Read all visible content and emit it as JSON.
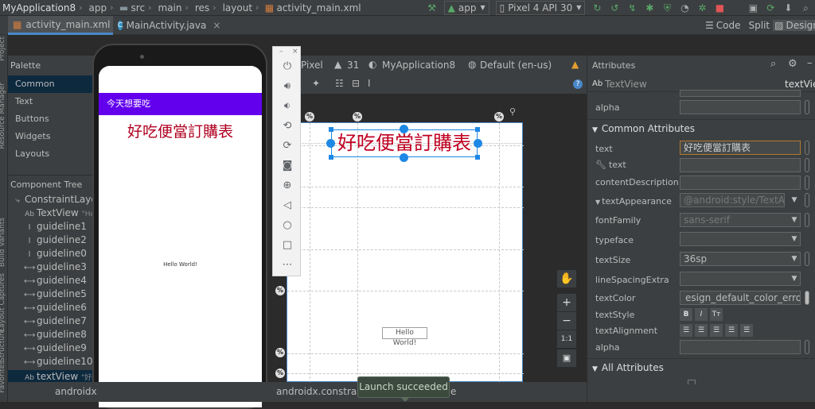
{
  "toolbar": {
    "breadcrumbs": [
      "MyApplication8",
      "app",
      "src",
      "main",
      "res",
      "layout",
      "activity_main.xml"
    ],
    "run_config": "app",
    "device": "Pixel 4 API 30"
  },
  "tabs": [
    {
      "label": "activity_main.xml"
    },
    {
      "label": "MainActivity.java"
    }
  ],
  "view_modes": {
    "code": "Code",
    "split": "Split",
    "design": "Design"
  },
  "side_labels": {
    "project": "Project",
    "resource_manager": "Resource Manager",
    "build_variants": "Build Variants",
    "layout_captures": "Layout Captures",
    "structure": "Structure",
    "favorites": "Favorites"
  },
  "palette": {
    "title": "Palette",
    "items": [
      "Common",
      "Text",
      "Buttons",
      "Widgets",
      "Layouts"
    ]
  },
  "component_tree": {
    "title": "Component Tree",
    "items": [
      {
        "label": "ConstraintLayout",
        "detail": ""
      },
      {
        "label": "TextView",
        "detail": "\"He"
      },
      {
        "label": "guideline1",
        "detail": ""
      },
      {
        "label": "guideline2",
        "detail": ""
      },
      {
        "label": "guideline0",
        "detail": ""
      },
      {
        "label": "guideline3",
        "detail": ""
      },
      {
        "label": "guideline4",
        "detail": ""
      },
      {
        "label": "guideline5",
        "detail": ""
      },
      {
        "label": "guideline6",
        "detail": ""
      },
      {
        "label": "guideline7",
        "detail": ""
      },
      {
        "label": "guideline8",
        "detail": ""
      },
      {
        "label": "guideline9",
        "detail": ""
      },
      {
        "label": "guideline10",
        "detail": ""
      },
      {
        "label": "textView",
        "detail": "\"好吃"
      }
    ]
  },
  "phone": {
    "app_title": "今天想要吃",
    "heading": "好吃便當訂購表",
    "hello": "Hello World!"
  },
  "design_toolbar": {
    "device": "Pixel",
    "api": "31",
    "theme": "MyApplication8",
    "locale": "Default (en-us)"
  },
  "canvas": {
    "selected_text": "好吃便當訂購表",
    "hello": "Hello World!",
    "guideline_marker": "%",
    "zoom_fit": "1:1"
  },
  "bottom": {
    "path": "androidx.constraint",
    "path2": "androidx",
    "path_tail": "e",
    "toast": "Launch succeeded"
  },
  "attributes": {
    "title": "Attributes",
    "widget": "TextView",
    "widget_id": "textVie",
    "rows_top": [
      {
        "label": "alpha",
        "value": ""
      }
    ],
    "common_section": "Common Attributes",
    "rows": [
      {
        "label": "text",
        "value": "好吃便當訂購表"
      },
      {
        "label": "text",
        "value": ""
      },
      {
        "label": "contentDescription",
        "value": ""
      },
      {
        "label": "textAppearance",
        "value": "@android:style/TextApp"
      },
      {
        "label": "fontFamily",
        "value": "sans-serif"
      },
      {
        "label": "typeface",
        "value": ""
      },
      {
        "label": "textSize",
        "value": "36sp"
      },
      {
        "label": "lineSpacingExtra",
        "value": ""
      },
      {
        "label": "textColor",
        "value": "esign_default_color_error"
      },
      {
        "label": "textStyle",
        "value": ""
      },
      {
        "label": "textAlignment",
        "value": ""
      },
      {
        "label": "alpha",
        "value": ""
      }
    ],
    "all_section": "All Attributes",
    "text_color_swatch": "#b00020"
  }
}
